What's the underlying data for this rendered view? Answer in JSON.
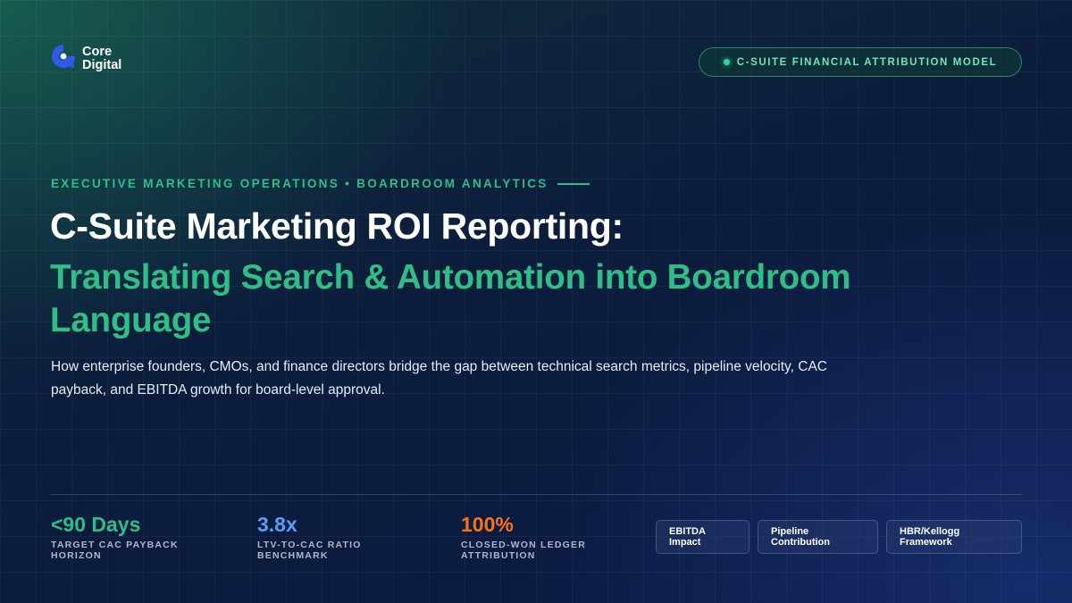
{
  "brand": {
    "name_line1": "Core",
    "name_line2": "Digital",
    "logo_color": "#2f5bea"
  },
  "badge": {
    "label": "C-SUITE FINANCIAL ATTRIBUTION MODEL",
    "dot_color": "#34d399"
  },
  "hero": {
    "eyebrow": "EXECUTIVE MARKETING OPERATIONS • BOARDROOM ANALYTICS",
    "title": "C-Suite Marketing ROI Reporting:",
    "subtitle": "Translating Search & Automation into Boardroom Language",
    "description": "How enterprise founders, CMOs, and finance directors bridge the gap between technical search metrics, pipeline velocity, CAC payback, and EBITDA growth for board-level approval."
  },
  "stats": [
    {
      "value": "<90 Days",
      "label_line1": "TARGET CAC PAYBACK",
      "label_line2": "HORIZON",
      "color": "#2fbf86"
    },
    {
      "value": "3.8x",
      "label_line1": "LTV-TO-CAC RATIO",
      "label_line2": "BENCHMARK",
      "color": "#5b9cf5"
    },
    {
      "value": "100%",
      "label_line1": "CLOSED-WON LEDGER",
      "label_line2": "ATTRIBUTION",
      "color": "#f97316"
    }
  ],
  "tags": [
    {
      "line1": "EBITDA",
      "line2": "Impact"
    },
    {
      "line1": "Pipeline",
      "line2": "Contribution"
    },
    {
      "line1": "HBR/Kellogg",
      "line2": "Framework"
    }
  ],
  "colors": {
    "accent_green": "#2fbf86",
    "accent_blue": "#5b9cf5",
    "accent_orange": "#f97316",
    "background": "#0c1d3c"
  }
}
